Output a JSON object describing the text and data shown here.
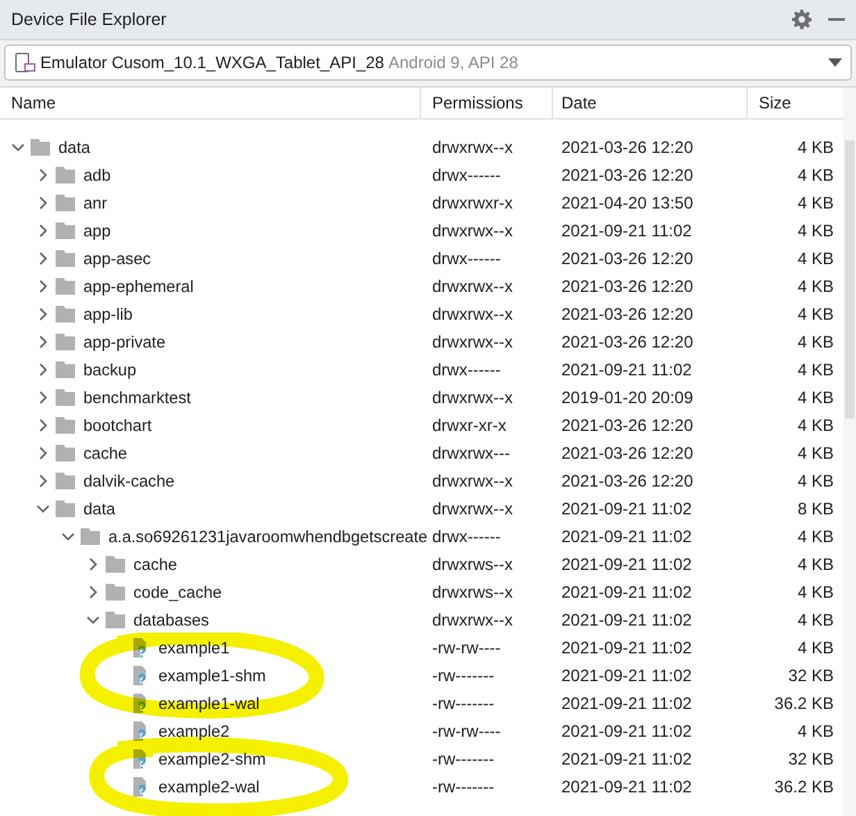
{
  "window": {
    "title": "Device File Explorer"
  },
  "device_selector": {
    "device": "Emulator Cusom_10.1_WXGA_Tablet_API_28",
    "details": "Android 9, API 28"
  },
  "table": {
    "columns": [
      "Name",
      "Permissions",
      "Date",
      "Size"
    ]
  },
  "tree": [
    {
      "kind": "folder",
      "name": "data",
      "permissions": "drwxrwx--x",
      "date": "2021-03-26 12:20",
      "size": "4 KB",
      "expanded": true,
      "children": [
        {
          "kind": "folder",
          "name": "adb",
          "permissions": "drwx------",
          "date": "2021-03-26 12:20",
          "size": "4 KB",
          "expanded": false
        },
        {
          "kind": "folder",
          "name": "anr",
          "permissions": "drwxrwxr-x",
          "date": "2021-04-20 13:50",
          "size": "4 KB",
          "expanded": false
        },
        {
          "kind": "folder",
          "name": "app",
          "permissions": "drwxrwx--x",
          "date": "2021-09-21 11:02",
          "size": "4 KB",
          "expanded": false
        },
        {
          "kind": "folder",
          "name": "app-asec",
          "permissions": "drwx------",
          "date": "2021-03-26 12:20",
          "size": "4 KB",
          "expanded": false
        },
        {
          "kind": "folder",
          "name": "app-ephemeral",
          "permissions": "drwxrwx--x",
          "date": "2021-03-26 12:20",
          "size": "4 KB",
          "expanded": false
        },
        {
          "kind": "folder",
          "name": "app-lib",
          "permissions": "drwxrwx--x",
          "date": "2021-03-26 12:20",
          "size": "4 KB",
          "expanded": false
        },
        {
          "kind": "folder",
          "name": "app-private",
          "permissions": "drwxrwx--x",
          "date": "2021-03-26 12:20",
          "size": "4 KB",
          "expanded": false
        },
        {
          "kind": "folder",
          "name": "backup",
          "permissions": "drwx------",
          "date": "2021-09-21 11:02",
          "size": "4 KB",
          "expanded": false
        },
        {
          "kind": "folder",
          "name": "benchmarktest",
          "permissions": "drwxrwx--x",
          "date": "2019-01-20 20:09",
          "size": "4 KB",
          "expanded": false
        },
        {
          "kind": "folder",
          "name": "bootchart",
          "permissions": "drwxr-xr-x",
          "date": "2021-03-26 12:20",
          "size": "4 KB",
          "expanded": false
        },
        {
          "kind": "folder",
          "name": "cache",
          "permissions": "drwxrwx---",
          "date": "2021-03-26 12:20",
          "size": "4 KB",
          "expanded": false
        },
        {
          "kind": "folder",
          "name": "dalvik-cache",
          "permissions": "drwxrwx--x",
          "date": "2021-03-26 12:20",
          "size": "4 KB",
          "expanded": false
        },
        {
          "kind": "folder",
          "name": "data",
          "permissions": "drwxrwx--x",
          "date": "2021-09-21 11:02",
          "size": "8 KB",
          "expanded": true,
          "children": [
            {
              "kind": "folder",
              "name": "a.a.so69261231javaroomwhendbgetscreate",
              "permissions": "drwx------",
              "date": "2021-09-21 11:02",
              "size": "4 KB",
              "expanded": true,
              "children": [
                {
                  "kind": "folder",
                  "name": "cache",
                  "permissions": "drwxrws--x",
                  "date": "2021-09-21 11:02",
                  "size": "4 KB",
                  "expanded": false
                },
                {
                  "kind": "folder",
                  "name": "code_cache",
                  "permissions": "drwxrws--x",
                  "date": "2021-09-21 11:02",
                  "size": "4 KB",
                  "expanded": false
                },
                {
                  "kind": "folder",
                  "name": "databases",
                  "permissions": "drwxrwx--x",
                  "date": "2021-09-21 11:02",
                  "size": "4 KB",
                  "expanded": true,
                  "children": [
                    {
                      "kind": "file",
                      "name": "example1",
                      "permissions": "-rw-rw----",
                      "date": "2021-09-21 11:02",
                      "size": "4 KB"
                    },
                    {
                      "kind": "file",
                      "name": "example1-shm",
                      "permissions": "-rw-------",
                      "date": "2021-09-21 11:02",
                      "size": "32 KB"
                    },
                    {
                      "kind": "file",
                      "name": "example1-wal",
                      "permissions": "-rw-------",
                      "date": "2021-09-21 11:02",
                      "size": "36.2 KB"
                    },
                    {
                      "kind": "file",
                      "name": "example2",
                      "permissions": "-rw-rw----",
                      "date": "2021-09-21 11:02",
                      "size": "4 KB"
                    },
                    {
                      "kind": "file",
                      "name": "example2-shm",
                      "permissions": "-rw-------",
                      "date": "2021-09-21 11:02",
                      "size": "32 KB"
                    },
                    {
                      "kind": "file",
                      "name": "example2-wal",
                      "permissions": "-rw-------",
                      "date": "2021-09-21 11:02",
                      "size": "36.2 KB"
                    }
                  ]
                }
              ]
            }
          ]
        }
      ]
    }
  ]
}
